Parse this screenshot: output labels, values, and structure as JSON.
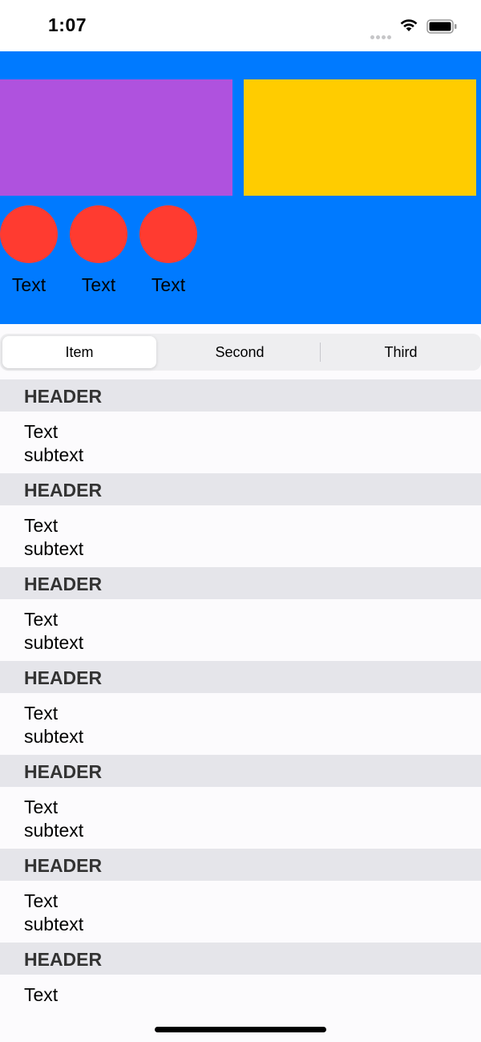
{
  "status_bar": {
    "time": "1:07",
    "icons": [
      "signal-icon",
      "wifi-icon",
      "battery-icon"
    ]
  },
  "colors": {
    "hero_background": "#007aff",
    "card_purple": "#af52de",
    "card_yellow": "#ffcc00",
    "circle": "#ff3b30",
    "header_background": "#e5e5ea"
  },
  "hero": {
    "circles": [
      {
        "label": "Text"
      },
      {
        "label": "Text"
      },
      {
        "label": "Text"
      }
    ]
  },
  "segmented_control": {
    "segments": [
      "Item",
      "Second",
      "Third"
    ],
    "selected": "Item"
  },
  "list": {
    "sections": [
      {
        "header": "HEADER",
        "title": "Text",
        "subtitle": "subtext"
      },
      {
        "header": "HEADER",
        "title": "Text",
        "subtitle": "subtext"
      },
      {
        "header": "HEADER",
        "title": "Text",
        "subtitle": "subtext"
      },
      {
        "header": "HEADER",
        "title": "Text",
        "subtitle": "subtext"
      },
      {
        "header": "HEADER",
        "title": "Text",
        "subtitle": "subtext"
      },
      {
        "header": "HEADER",
        "title": "Text",
        "subtitle": "subtext"
      },
      {
        "header": "HEADER",
        "title": "Text",
        "subtitle": ""
      }
    ]
  }
}
